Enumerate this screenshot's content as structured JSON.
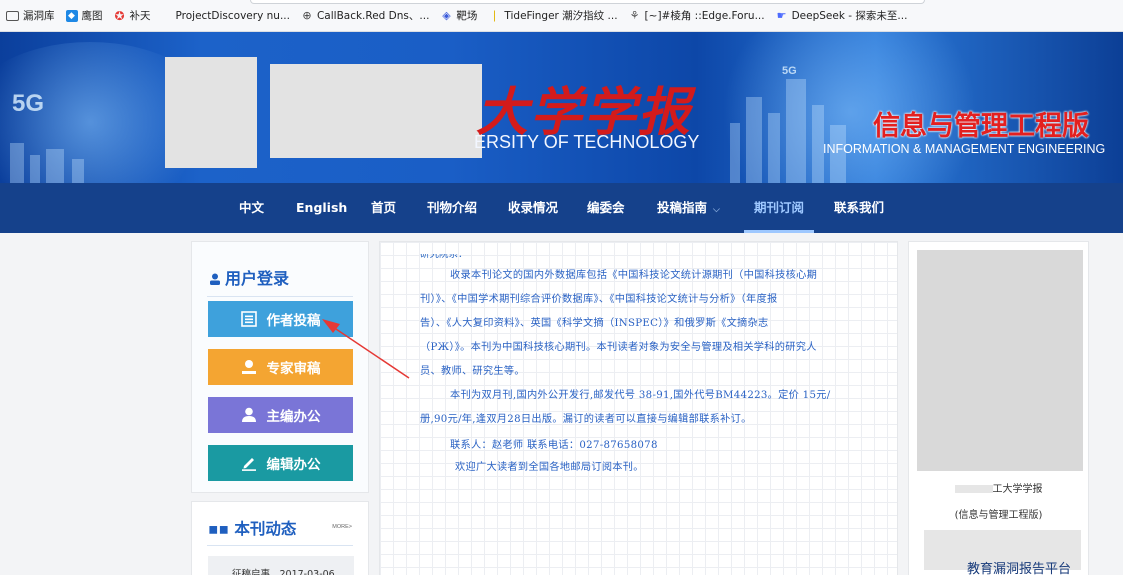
{
  "bookmarks": [
    {
      "label": "漏洞库",
      "icon": "folder-icon"
    },
    {
      "label": "鹰图",
      "icon": "eagle-icon"
    },
    {
      "label": "补天",
      "icon": "star-icon"
    },
    {
      "label": "ProjectDiscovery nu...",
      "icon": "blank-icon"
    },
    {
      "label": "CallBack.Red Dns、...",
      "icon": "globe-icon"
    },
    {
      "label": "靶场",
      "icon": "shield-icon"
    },
    {
      "label": "TideFinger 潮汐指纹 ...",
      "icon": "leaf-icon"
    },
    {
      "label": "[~]#棱角 ::Edge.Foru...",
      "icon": "ant-icon"
    },
    {
      "label": "DeepSeek - 探索未至...",
      "icon": "deepseek-icon"
    }
  ],
  "banner": {
    "title_cn": "大学学报",
    "title_en": "ERSITY OF TECHNOLOGY",
    "edition_cn": "信息与管理工程版",
    "edition_en": "INFORMATION & MANAGEMENT ENGINEERING",
    "badge_5g": "5G"
  },
  "nav": {
    "items": [
      "中文",
      "English",
      "首页",
      "刊物介绍",
      "收录情况",
      "编委会",
      "投稿指南",
      "期刊订阅",
      "联系我们"
    ],
    "active": "期刊订阅"
  },
  "login": {
    "title": "用户登录",
    "buttons": [
      "作者投稿",
      "专家审稿",
      "主编办公",
      "编辑办公"
    ]
  },
  "news": {
    "title": "本刊动态",
    "more": "MORE>",
    "first_item": "征稿启事　2017-03-06"
  },
  "content": {
    "lines": [
      "收录本刊论文的国内外数据库包括《中国科技论文统计源期刊（中国科技核心期",
      "刊）》、《中国学术期刊综合评价数据库》、《中国科技论文统计与分析》（年度报",
      "告）、《人大复印资料》、英国《科学文摘（INSPEC）》和俄罗斯《文摘杂志",
      "（PЖ）》。本刊为中国科技核心期刊。本刊读者对象为安全与管理及相关学科的研究人",
      "员、教师、研究生等。",
      "本刊为双月刊,国内外公开发行,邮发代号 38-91,国外代号BM44223。定价 15元/",
      "册,90元/年,逢双月28日出版。漏订的读者可以直接与编辑部联系补订。",
      "联系人：赵老师            联系电话：027-87658078",
      "欢迎广大读者到全国各地邮局订阅本刊。"
    ]
  },
  "journal": {
    "name": "工大学学报",
    "subtitle": "(信息与管理工程版)"
  },
  "footer": {
    "platform": "教育漏洞报告平台"
  }
}
